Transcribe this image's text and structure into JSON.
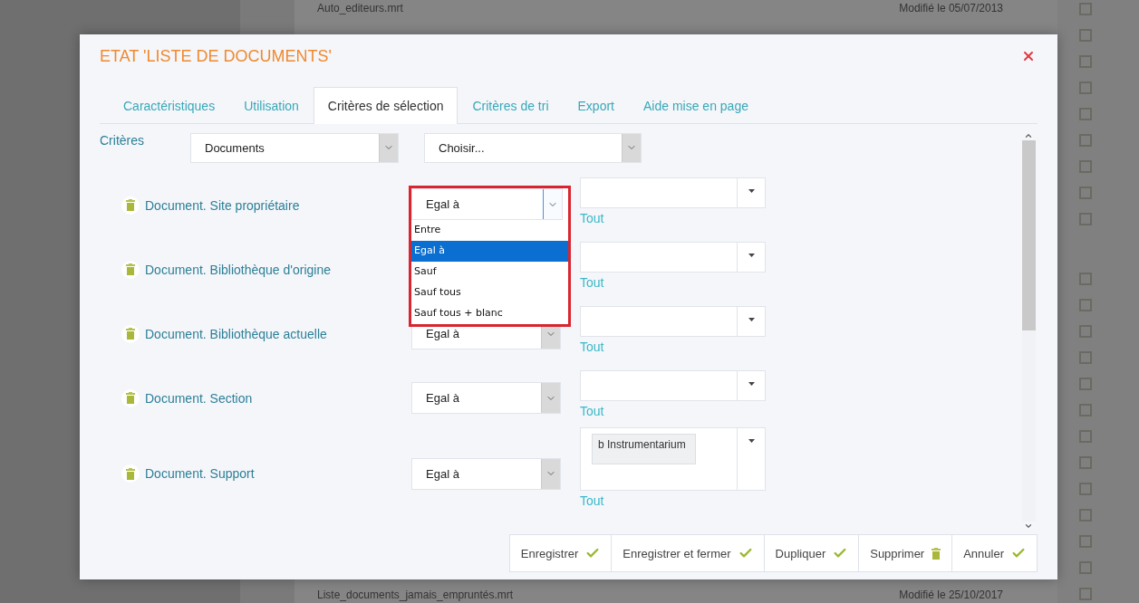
{
  "background": {
    "rows": [
      {
        "name": "Auto_editeurs.mrt",
        "modified": "Modifié le 05/07/2013"
      },
      {
        "name": "Liste_documents_jamais_empruntés.mrt",
        "modified": "Modifié le 25/10/2017"
      }
    ],
    "checkboxes": [
      {
        "checked": false
      },
      {
        "checked": false
      },
      {
        "checked": false
      },
      {
        "checked": false
      },
      {
        "checked": false
      },
      {
        "checked": false
      },
      {
        "checked": false
      },
      {
        "checked": false
      },
      {
        "checked": false
      },
      {
        "checked": false
      },
      {
        "checked": false
      },
      {
        "checked": false
      },
      {
        "checked": false
      },
      {
        "checked": false
      },
      {
        "checked": false
      },
      {
        "checked": false
      },
      {
        "checked": false
      },
      {
        "checked": false
      },
      {
        "checked": false
      },
      {
        "checked": false
      },
      {
        "checked": false
      },
      {
        "checked": false
      }
    ]
  },
  "dialog": {
    "title": "ETAT 'LISTE DE DOCUMENTS'",
    "tabs": [
      {
        "label": "Caractéristiques",
        "selected": false
      },
      {
        "label": "Utilisation",
        "selected": false
      },
      {
        "label": "Critères de sélection",
        "selected": true
      },
      {
        "label": "Critères de tri",
        "selected": false
      },
      {
        "label": "Export",
        "selected": false
      },
      {
        "label": "Aide mise en page",
        "selected": false
      }
    ],
    "criteria": {
      "label": "Critères",
      "entity": "Documents",
      "field": "Choisir..."
    },
    "rows": [
      {
        "label": "Document. Site propriétaire",
        "operator": "Egal à",
        "open": true,
        "options": [
          {
            "label": "Entre",
            "selected": false
          },
          {
            "label": "Egal à",
            "selected": true
          },
          {
            "label": "Sauf",
            "selected": false
          },
          {
            "label": "Sauf tous",
            "selected": false
          },
          {
            "label": "Sauf tous + blanc",
            "selected": false
          }
        ],
        "values": [],
        "link": "Tout"
      },
      {
        "label": "Document. Bibliothèque d'origine",
        "open": false,
        "values": [],
        "link": "Tout"
      },
      {
        "label": "Document. Bibliothèque actuelle",
        "operator": "Egal à",
        "open": false,
        "values": [],
        "link": "Tout"
      },
      {
        "label": "Document. Section",
        "operator": "Egal à",
        "open": false,
        "values": [],
        "link": "Tout"
      },
      {
        "label": "Document. Support",
        "operator": "Egal à",
        "open": false,
        "values": [
          "b Instrumentarium"
        ],
        "link": "Tout"
      }
    ],
    "buttons": [
      {
        "label": "Enregistrer",
        "kind": "check"
      },
      {
        "label": "Enregistrer et fermer",
        "kind": "check"
      },
      {
        "label": "Dupliquer",
        "kind": "check"
      },
      {
        "label": "Supprimer",
        "kind": "trash"
      },
      {
        "label": "Annuler",
        "kind": "check"
      }
    ]
  }
}
